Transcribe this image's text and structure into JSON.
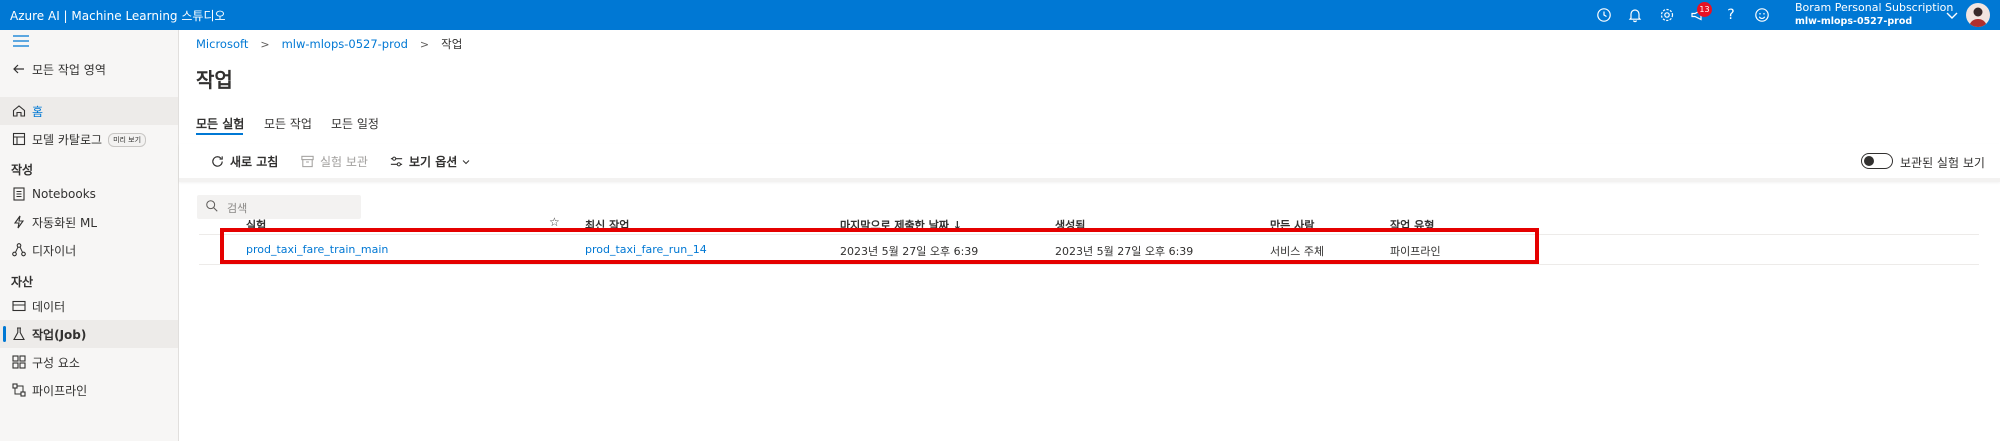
{
  "app": {
    "title": "Azure AI | Machine Learning 스튜디오"
  },
  "account": {
    "subscription": "Boram Personal Subscription",
    "workspace": "mlw-mlops-0527-prod",
    "notification_count": "13"
  },
  "topbar_icons": [
    "history-icon",
    "bell-icon",
    "settings-icon",
    "announcement-icon",
    "help-icon",
    "feedback-icon"
  ],
  "sidebar": {
    "back_label": "모든 작업 영역",
    "home_label": "홈",
    "model_catalog_label": "모델 카탈로그",
    "preview_badge": "미리 보기",
    "authoring_header": "작성",
    "notebooks_label": "Notebooks",
    "automl_label": "자동화된 ML",
    "designer_label": "디자이너",
    "assets_header": "자산",
    "data_label": "데이터",
    "jobs_label": "작업(Job)",
    "components_label": "구성 요소",
    "pipelines_label": "파이프라인"
  },
  "breadcrumb": {
    "item1": "Microsoft",
    "item2": "mlw-mlops-0527-prod",
    "item3": "작업"
  },
  "page": {
    "title": "작업"
  },
  "tabs": {
    "all_experiments": "모든 실험",
    "all_jobs": "모든 작업",
    "all_schedules": "모든 일정"
  },
  "toolbar": {
    "refresh": "새로 고침",
    "archive": "실험 보관",
    "view_options": "보기 옵션",
    "show_archived": "보관된 실험 보기",
    "show_archived_on": false
  },
  "search": {
    "placeholder": "검색"
  },
  "table": {
    "headers": {
      "experiment": "실험",
      "star": "☆",
      "latest_job": "최신 작업",
      "last_submitted": "마지막으로 제출한 날짜 ↓",
      "created": "생성됨",
      "created_by": "만든 사람",
      "job_type": "작업 유형"
    },
    "rows": [
      {
        "experiment": "prod_taxi_fare_train_main",
        "latest_job": "prod_taxi_fare_run_14",
        "last_submitted": "2023년 5월 27일 오후 6:39",
        "created": "2023년 5월 27일 오후 6:39",
        "created_by": "서비스 주체",
        "job_type": "파이프라인"
      }
    ]
  },
  "colors": {
    "accent": "#0078d4",
    "highlight": "#e50000",
    "badge": "#e81123"
  }
}
